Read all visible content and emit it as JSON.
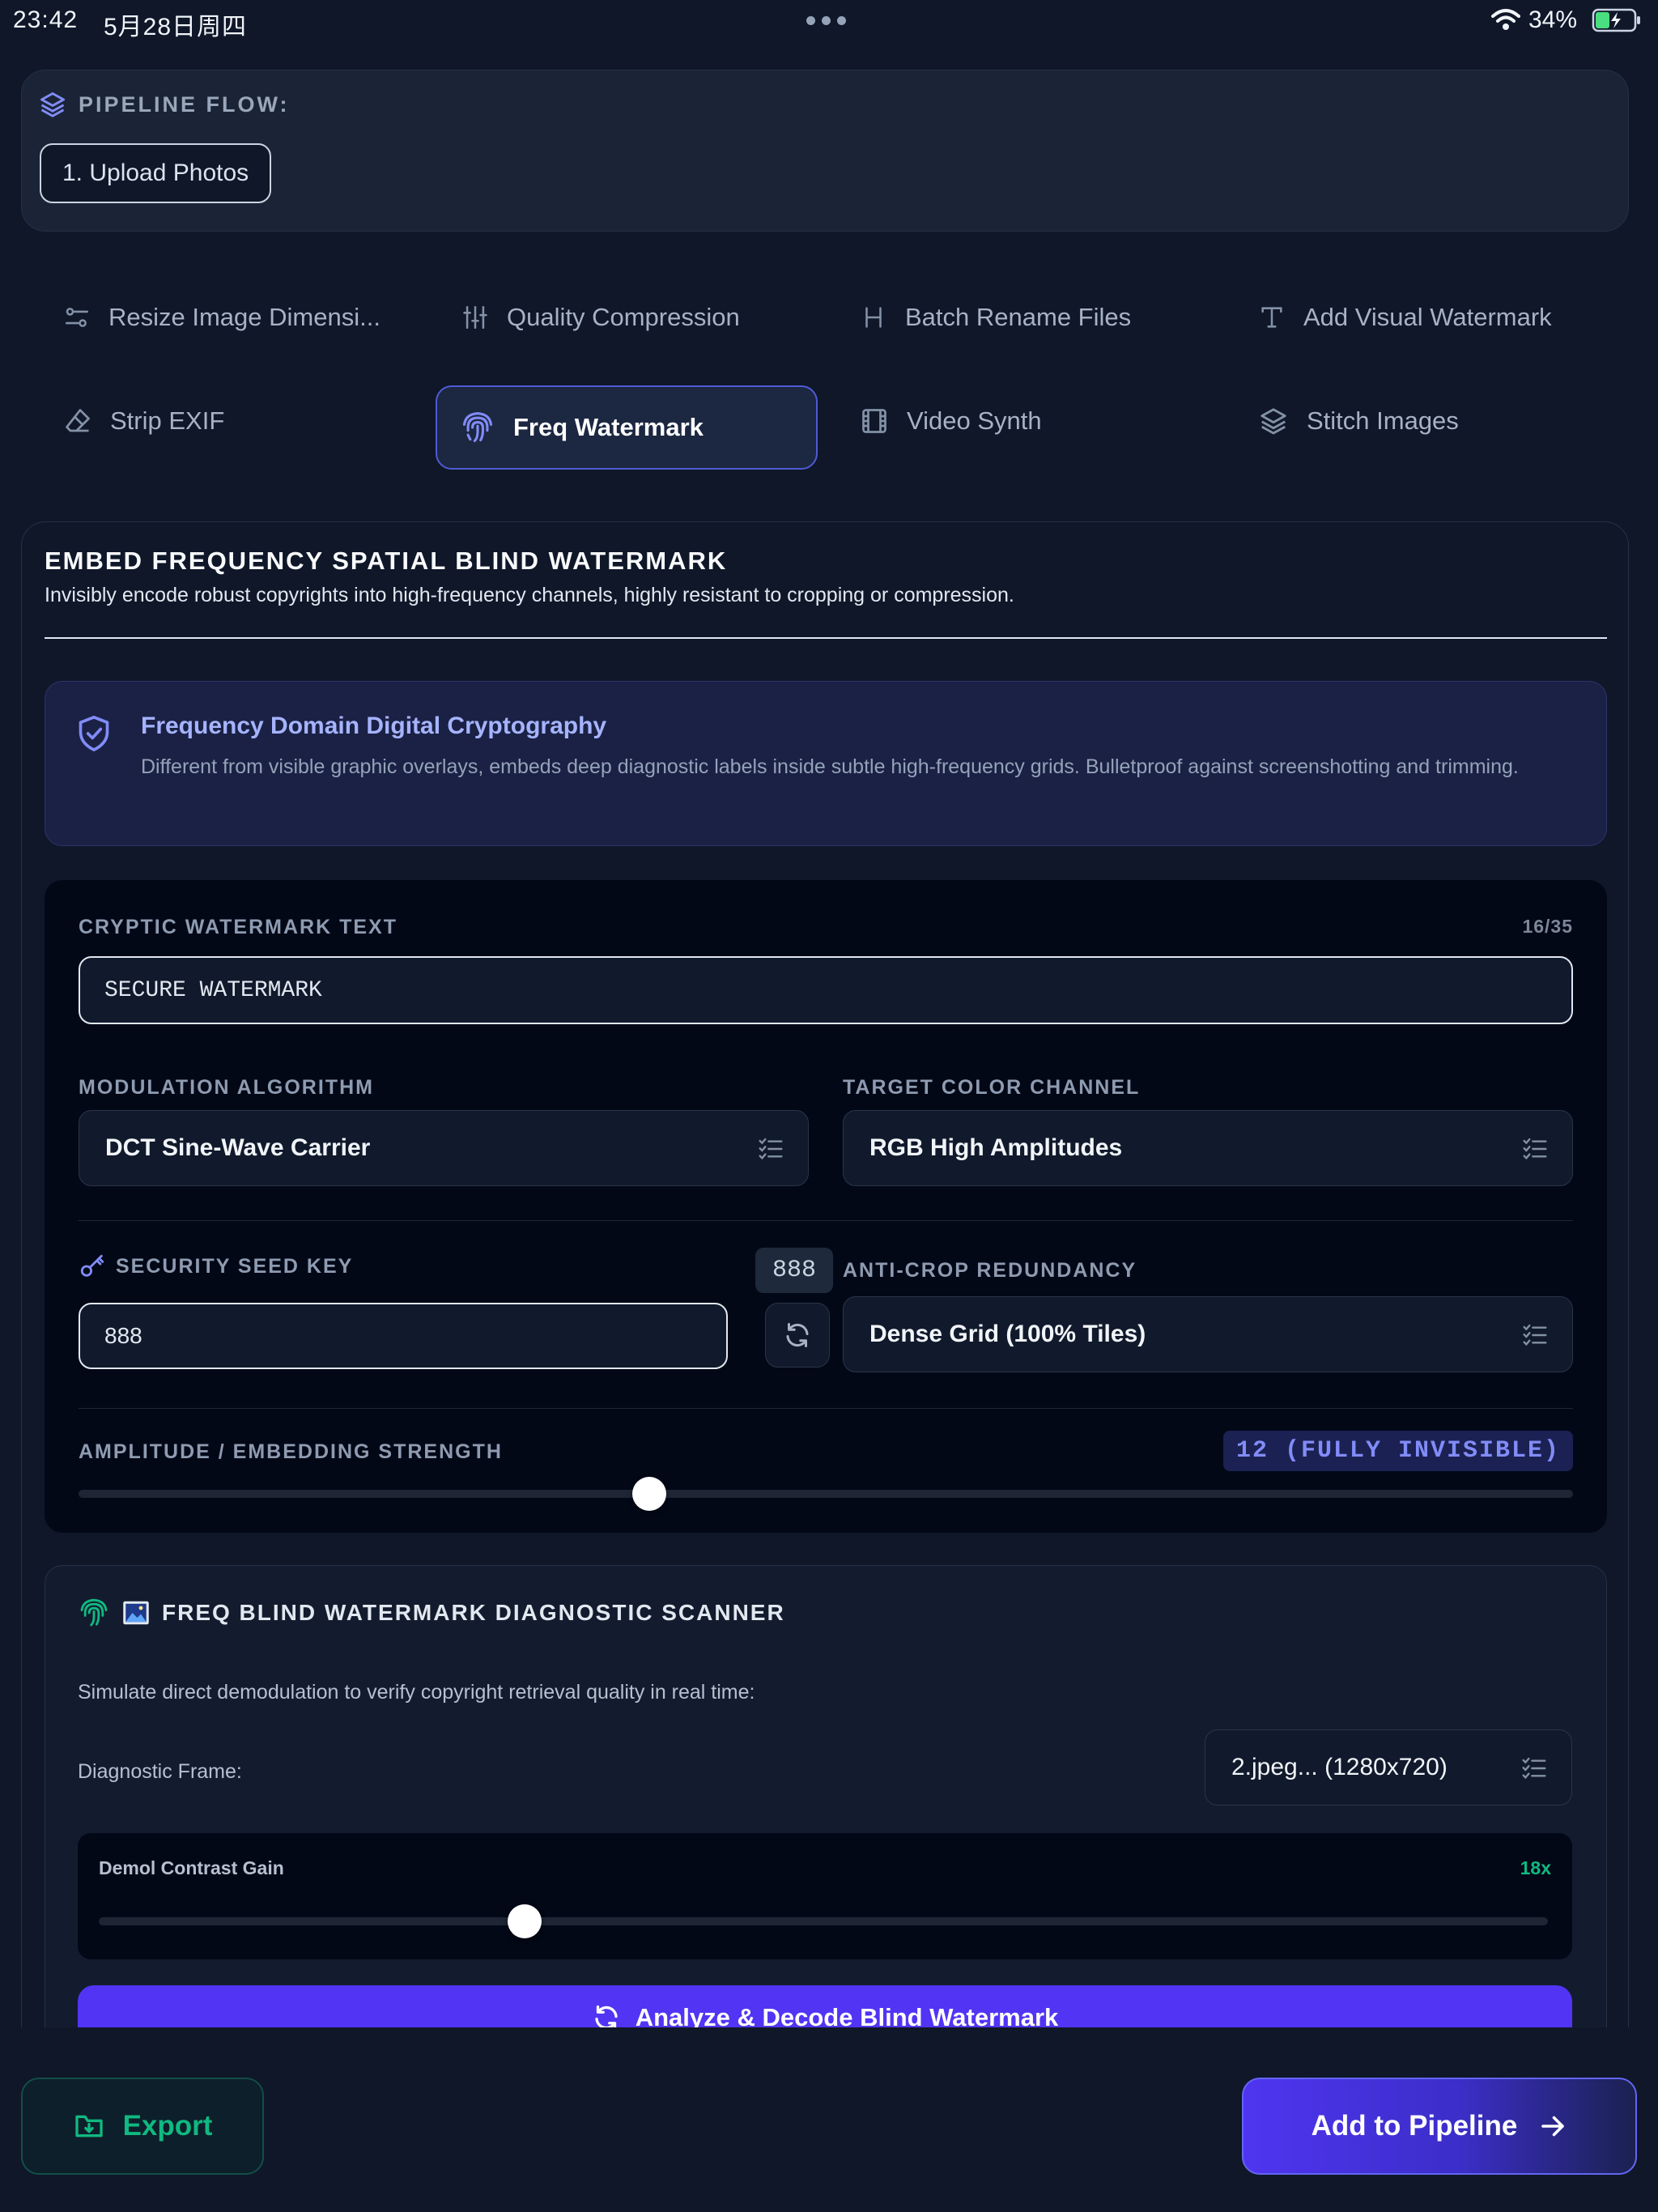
{
  "status_bar": {
    "time": "23:42",
    "date": "5月28日周四",
    "battery": "34%"
  },
  "pipeline": {
    "label": "PIPELINE FLOW:",
    "steps": [
      "1. Upload Photos"
    ]
  },
  "tabs": [
    {
      "label": "Resize Image Dimensi...",
      "icon": "sliders-icon"
    },
    {
      "label": "Quality Compression",
      "icon": "equalizer-icon"
    },
    {
      "label": "Batch Rename Files",
      "icon": "heading-icon"
    },
    {
      "label": "Add Visual Watermark",
      "icon": "type-icon"
    },
    {
      "label": "Strip EXIF",
      "icon": "eraser-icon"
    },
    {
      "label": "Freq Watermark",
      "icon": "fingerprint-icon",
      "active": true
    },
    {
      "label": "Video Synth",
      "icon": "film-icon"
    },
    {
      "label": "Stitch Images",
      "icon": "layers-icon"
    }
  ],
  "panel": {
    "title": "EMBED FREQUENCY SPATIAL BLIND WATERMARK",
    "subtitle": "Invisibly encode robust copyrights into high-frequency channels, highly resistant to cropping or compression.",
    "info_title": "Frequency Domain Digital Cryptography",
    "info_body": "Different from visible graphic overlays, embeds deep diagnostic labels inside subtle high-frequency grids. Bulletproof against screenshotting and trimming."
  },
  "settings": {
    "watermark_label": "CRYPTIC WATERMARK TEXT",
    "watermark_count": "16/35",
    "watermark_value": "SECURE WATERMARK",
    "modulation_label": "MODULATION ALGORITHM",
    "modulation_value": "DCT Sine-Wave Carrier",
    "channel_label": "TARGET COLOR CHANNEL",
    "channel_value": "RGB High Amplitudes",
    "seed_label": "SECURITY SEED KEY",
    "seed_badge": "888",
    "seed_value": "888",
    "redundancy_label": "ANTI-CROP REDUNDANCY",
    "redundancy_value": "Dense Grid (100% Tiles)",
    "amplitude_label": "AMPLITUDE / EMBEDDING STRENGTH",
    "amplitude_badge": "12 (FULLY INVISIBLE)",
    "amplitude_fraction": 0.382
  },
  "scanner": {
    "title": "FREQ BLIND WATERMARK DIAGNOSTIC SCANNER",
    "description": "Simulate direct demodulation to verify copyright retrieval quality in real time:",
    "frame_label": "Diagnostic Frame:",
    "frame_value": "2.jpeg... (1280x720)",
    "gain_label": "Demol Contrast Gain",
    "gain_value": "18x",
    "gain_fraction": 0.294,
    "analyze_label": "Analyze & Decode Blind Watermark"
  },
  "footer": {
    "export_label": "Export",
    "add_label": "Add to Pipeline"
  },
  "colors": {
    "background": "#0f1729",
    "accent": "#5234f5",
    "indigo_text": "#a5b4fc",
    "green": "#10b981"
  }
}
